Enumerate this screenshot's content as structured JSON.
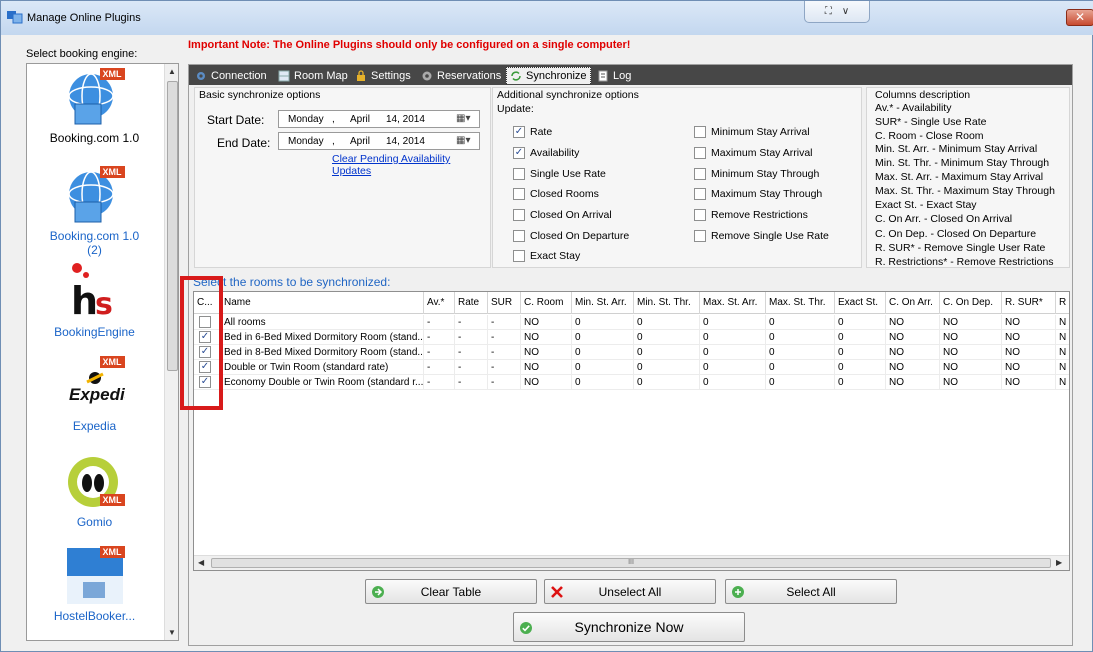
{
  "window": {
    "title": "Manage Online Plugins",
    "close_label": "✕"
  },
  "important_note": "Important Note: The Online Plugins should only be configured on a single computer!",
  "engine_panel": {
    "label": "Select booking engine:",
    "engines": [
      {
        "caption": "Booking.com 1.0",
        "badge": "XML",
        "selected": true
      },
      {
        "caption": "Booking.com 1.0\n(2)",
        "badge": "XML",
        "selected": false
      },
      {
        "caption": "BookingEngine",
        "badge": "",
        "selected": false
      },
      {
        "caption": "Expedia",
        "badge": "XML",
        "selected": false
      },
      {
        "caption": "Gomio",
        "badge": "XML",
        "selected": false
      },
      {
        "caption": "HostelBooker...",
        "badge": "XML",
        "selected": false
      }
    ]
  },
  "tabs": [
    {
      "label": "Connection",
      "icon": "gear-icon"
    },
    {
      "label": "Room Map",
      "icon": "map-icon"
    },
    {
      "label": "Settings",
      "icon": "lock-icon"
    },
    {
      "label": "Reservations",
      "icon": "gear-icon"
    },
    {
      "label": "Synchronize",
      "icon": "sync-icon",
      "active": true
    },
    {
      "label": "Log",
      "icon": "log-icon"
    }
  ],
  "basic_options": {
    "title": "Basic synchronize options",
    "start_label": "Start Date:",
    "end_label": "End Date:",
    "start_date": {
      "weekday": "Monday",
      "sep": ",",
      "month": "April",
      "day_year": "14, 2014"
    },
    "end_date": {
      "weekday": "Monday",
      "sep": ",",
      "month": "April",
      "day_year": "14, 2014"
    },
    "clear_link": "Clear Pending Availability Updates"
  },
  "additional_options": {
    "title": "Additional synchronize options",
    "update_label": "Update:",
    "left": [
      {
        "label": "Rate",
        "checked": true
      },
      {
        "label": "Availability",
        "checked": true
      },
      {
        "label": "Single Use Rate",
        "checked": false
      },
      {
        "label": "Closed Rooms",
        "checked": false
      },
      {
        "label": "Closed On Arrival",
        "checked": false
      },
      {
        "label": "Closed On Departure",
        "checked": false
      },
      {
        "label": "Exact Stay",
        "checked": false
      }
    ],
    "right": [
      {
        "label": "Minimum Stay Arrival",
        "checked": false
      },
      {
        "label": "Maximum Stay Arrival",
        "checked": false
      },
      {
        "label": "Minimum Stay Through",
        "checked": false
      },
      {
        "label": "Maximum Stay Through",
        "checked": false
      },
      {
        "label": "Remove Restrictions",
        "checked": false
      },
      {
        "label": "Remove Single Use Rate",
        "checked": false
      }
    ]
  },
  "columns_description": {
    "title": "Columns description",
    "lines": [
      "Av.* - Availability",
      "SUR* - Single Use Rate",
      "C. Room - Close Room",
      "Min. St. Arr. - Minimum Stay Arrival",
      "Min. St. Thr. - Minimum Stay Through",
      "Max. St. Arr. - Maximum Stay Arrival",
      "Max. St. Thr. - Maximum Stay Through",
      "Exact St. - Exact Stay",
      "C. On Arr. - Closed On Arrival",
      "C. On Dep. - Closed On Departure",
      "R. SUR* - Remove Single User Rate",
      "R. Restrictions* - Remove Restrictions"
    ]
  },
  "grid": {
    "label": "Select the rooms to be synchronized:",
    "columns": [
      "C...",
      "Name",
      "Av.*",
      "Rate",
      "SUR",
      "C. Room",
      "Min. St. Arr.",
      "Min. St. Thr.",
      "Max. St. Arr.",
      "Max. St. Thr.",
      "Exact St.",
      "C. On Arr.",
      "C. On Dep.",
      "R. SUR*",
      "R"
    ],
    "rows": [
      {
        "checked": false,
        "cells": [
          "All rooms",
          "-",
          "-",
          "-",
          "NO",
          "0",
          "0",
          "0",
          "0",
          "0",
          "NO",
          "NO",
          "NO",
          "N"
        ]
      },
      {
        "checked": true,
        "cells": [
          "Bed in 6-Bed Mixed Dormitory Room (stand...",
          "-",
          "-",
          "-",
          "NO",
          "0",
          "0",
          "0",
          "0",
          "0",
          "NO",
          "NO",
          "NO",
          "N"
        ]
      },
      {
        "checked": true,
        "cells": [
          "Bed in 8-Bed Mixed Dormitory Room (stand...",
          "-",
          "-",
          "-",
          "NO",
          "0",
          "0",
          "0",
          "0",
          "0",
          "NO",
          "NO",
          "NO",
          "N"
        ]
      },
      {
        "checked": true,
        "cells": [
          "Double or Twin Room (standard rate)",
          "-",
          "-",
          "-",
          "NO",
          "0",
          "0",
          "0",
          "0",
          "0",
          "NO",
          "NO",
          "NO",
          "N"
        ]
      },
      {
        "checked": true,
        "cells": [
          "Economy Double or Twin Room (standard r...",
          "-",
          "-",
          "-",
          "NO",
          "0",
          "0",
          "0",
          "0",
          "0",
          "NO",
          "NO",
          "NO",
          "N"
        ]
      }
    ],
    "scroll_grip": "III"
  },
  "buttons": {
    "clear_table": "Clear Table",
    "unselect_all": "Unselect All",
    "select_all": "Select All",
    "synchronize_now": "Synchronize Now"
  },
  "colors": {
    "accent": "#2166c4",
    "note_red": "#e00000",
    "highlight_red": "#d81a1a",
    "tabbar": "#474747"
  }
}
